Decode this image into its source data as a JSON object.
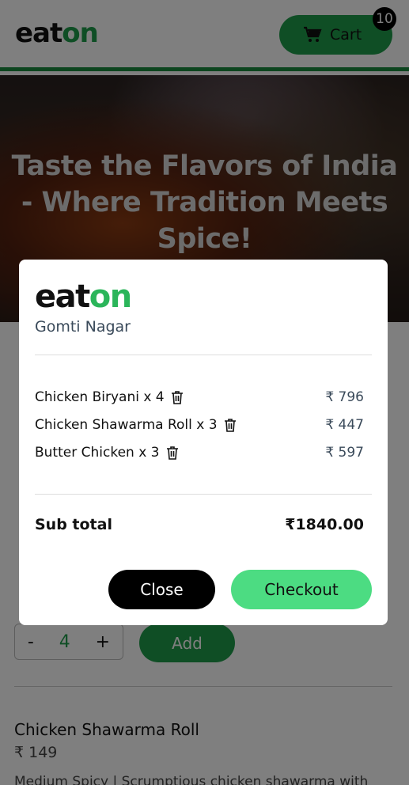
{
  "header": {
    "logo_eat": "eat",
    "logo_on": "on",
    "cart_label": "Cart",
    "cart_count": "10"
  },
  "hero": {
    "title": "Taste the Flavors of India - Where Tradition Meets Spice!"
  },
  "background_page": {
    "qty_minus": "-",
    "qty_value": "4",
    "qty_plus": "+",
    "add_label": "Add",
    "next_item_title": "Chicken Shawarma Roll",
    "next_item_price": "₹ 149",
    "next_item_desc": "Medium Spicy | Scrumptious chicken shawarma with"
  },
  "modal": {
    "logo_eat": "eat",
    "logo_on": "on",
    "location": "Gomti Nagar",
    "items": [
      {
        "name": "Chicken Biryani x 4",
        "price": "₹ 796"
      },
      {
        "name": "Chicken Shawarma Roll x 3",
        "price": "₹ 447"
      },
      {
        "name": "Butter Chicken x 3",
        "price": "₹ 597"
      }
    ],
    "subtotal_label": "Sub total",
    "subtotal_value": "₹1840.00",
    "close_label": "Close",
    "checkout_label": "Checkout"
  },
  "colors": {
    "brand_green": "#1f9d4a",
    "checkout_green": "#4cdc82"
  }
}
